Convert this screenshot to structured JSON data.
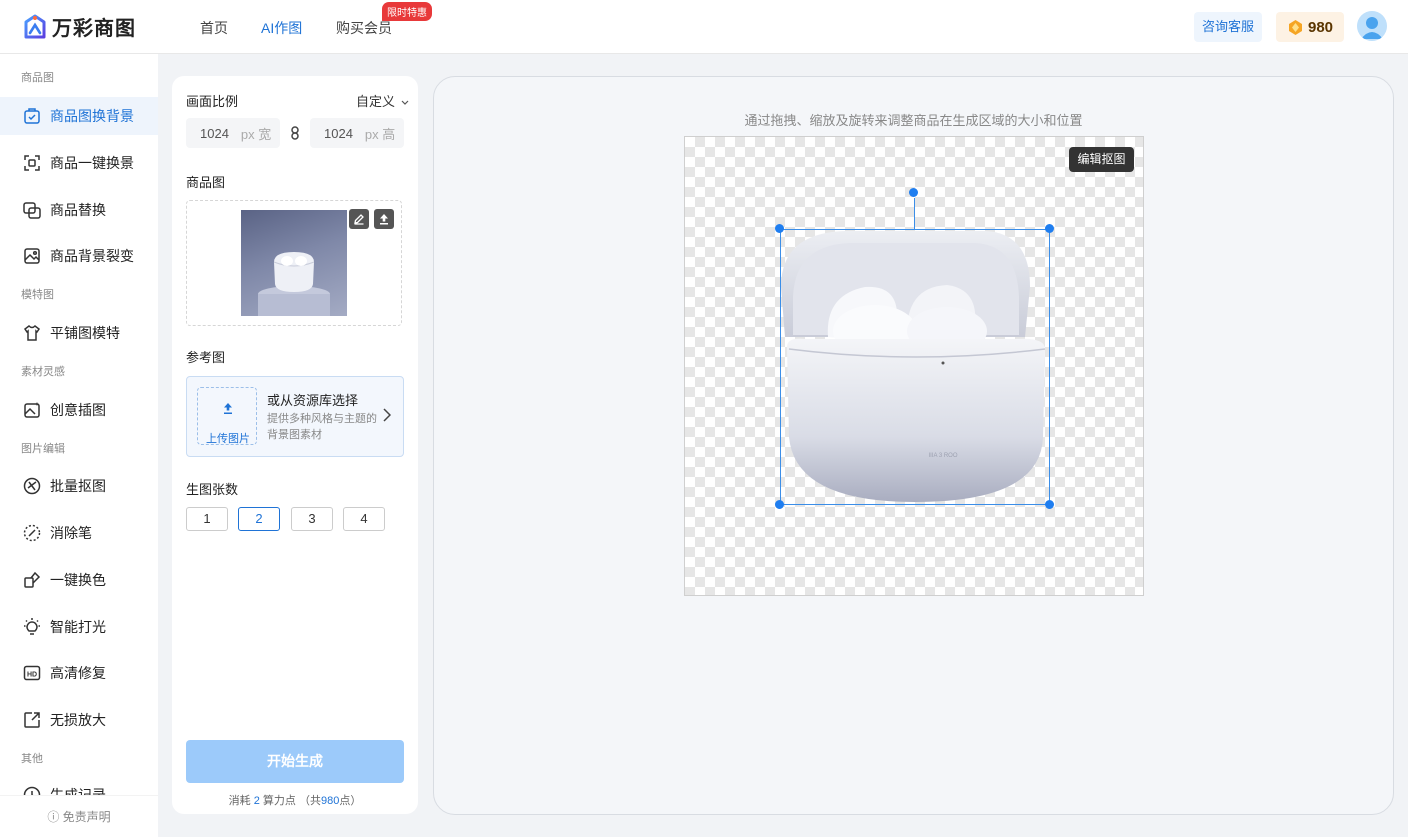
{
  "brand": {
    "name": "万彩商图"
  },
  "nav": [
    {
      "label": "首页",
      "active": false
    },
    {
      "label": "AI作图",
      "active": true
    },
    {
      "label": "购买会员",
      "active": false,
      "badge": "限时特惠"
    }
  ],
  "header": {
    "consult_label": "咨询客服",
    "points": "980"
  },
  "sidebar": {
    "sections": [
      "商品图",
      "模特图",
      "素材灵感",
      "图片编辑",
      "其他"
    ],
    "items": [
      {
        "label": "商品图换背景",
        "icon": "product-bg-icon",
        "active": true
      },
      {
        "label": "商品一键换景",
        "icon": "scene-swap-icon"
      },
      {
        "label": "商品替换",
        "icon": "product-replace-icon"
      },
      {
        "label": "商品背景裂变",
        "icon": "bg-variation-icon"
      },
      {
        "label": "平铺图模特",
        "icon": "shirt-model-icon"
      },
      {
        "label": "创意插图",
        "icon": "creative-image-icon"
      },
      {
        "label": "批量抠图",
        "icon": "batch-cutout-icon"
      },
      {
        "label": "消除笔",
        "icon": "eraser-pen-icon"
      },
      {
        "label": "一键换色",
        "icon": "recolor-icon"
      },
      {
        "label": "智能打光",
        "icon": "lightbulb-icon"
      },
      {
        "label": "高清修复",
        "icon": "hd-icon"
      },
      {
        "label": "无损放大",
        "icon": "enlarge-icon"
      },
      {
        "label": "生成记录",
        "icon": "history-icon"
      }
    ],
    "footer": "免责声明"
  },
  "panel": {
    "ratio_label": "画面比例",
    "ratio_value": "自定义",
    "width_value": "1024",
    "width_unit": "px 宽",
    "height_value": "1024",
    "height_unit": "px 高",
    "product_label": "商品图",
    "reference_label": "参考图",
    "upload_label": "上传图片",
    "library_title": "或从资源库选择",
    "library_desc": "提供多种风格与主题的背景图素材",
    "count_label": "生图张数",
    "counts": [
      "1",
      "2",
      "3",
      "4"
    ],
    "selected_count": "2",
    "generate_label": "开始生成",
    "cost_prefix": "消耗",
    "cost_value": "2",
    "cost_mid": "算力点 （共",
    "cost_total": "980",
    "cost_suffix": "点）"
  },
  "canvas": {
    "hint": "通过拖拽、缩放及旋转来调整商品在生成区域的大小和位置",
    "edit_cutout_label": "编辑抠图"
  },
  "colors": {
    "accent": "#1f73d6",
    "generate_disabled": "#9ccafa",
    "badge": "#e8393a"
  }
}
